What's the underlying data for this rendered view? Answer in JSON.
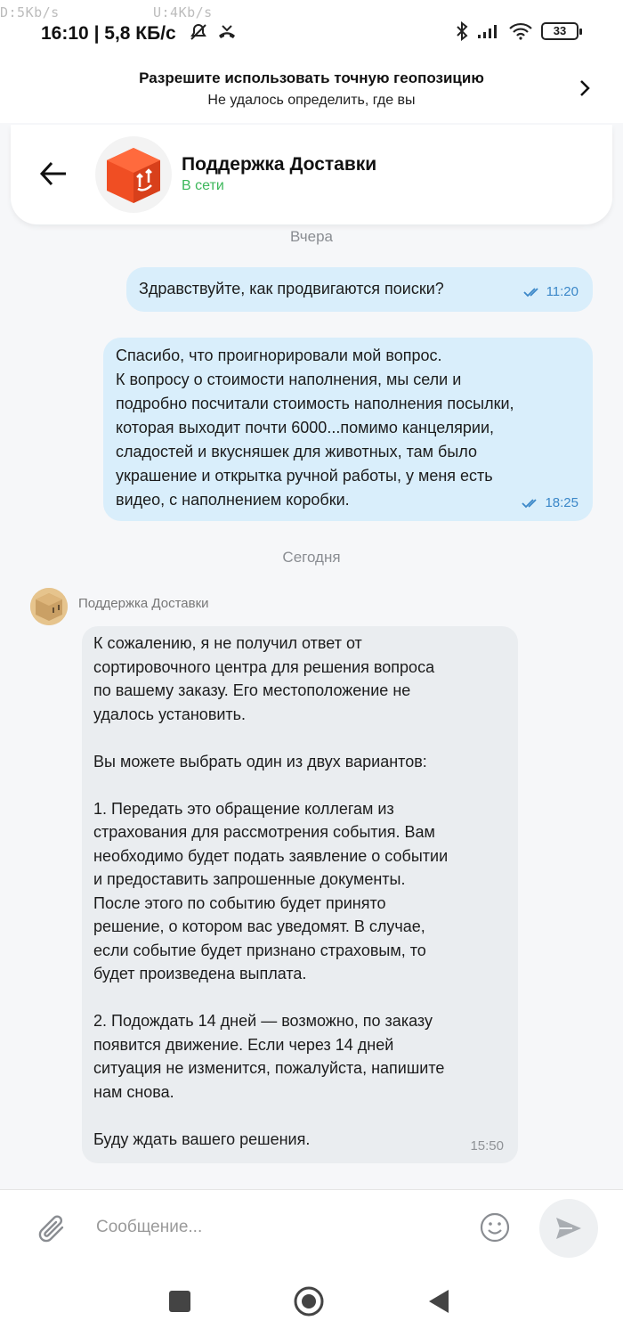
{
  "status_bar": {
    "net_down": "D:5Kb/s",
    "net_up": "U:4Kb/s",
    "time": "16:10",
    "speed": "| 5,8 КБ/с",
    "battery": "33"
  },
  "geo_banner": {
    "title": "Разрешите использовать точную геопозицию",
    "subtitle": "Не удалось определить, где вы"
  },
  "header": {
    "title": "Поддержка Доставки",
    "status": "В сети",
    "status_color": "#3cb75a",
    "brand_color": "#f04e23"
  },
  "dates": {
    "yesterday": "Вчера",
    "today": "Сегодня"
  },
  "messages": [
    {
      "direction": "outgoing",
      "text": "Здравствуйте, как продвигаются поиски?",
      "time": "11:20",
      "status_icon": "double-check-icon"
    },
    {
      "direction": "outgoing",
      "lines": [
        "Спасибо, что проигнорировали мой вопрос.",
        "К вопросу о стоимости наполнения, мы сели и",
        "подробно посчитали стоимость наполнения посылки,",
        "которая выходит почти 6000...помимо канцелярии,",
        "сладостей и вкусняшек для животных, там было",
        "украшение и открытка ручной работы, у меня есть",
        "видео, с наполнением коробки."
      ],
      "time": "18:25",
      "status_icon": "double-check-icon"
    },
    {
      "direction": "incoming",
      "sender": "Поддержка Доставки",
      "text": "К сожалению, я не получил ответ от\nсортировочного центра для решения вопроса\nпо вашему заказу. Его местоположение не\nудалось установить.\n\nВы можете выбрать один из двух вариантов:\n\n1. Передать это обращение коллегам из\nстрахования для рассмотрения события. Вам\nнеобходимо будет подать заявление о событии\nи предоставить запрошенные документы.\nПосле этого по событию будет принято\nрешение, о котором вас уведомят. В случае,\nесли событие будет признано страховым, то\nбудет произведена выплата.\n\n2. Подождать 14 дней — возможно, по заказу\nпоявится движение. Если через 14 дней\nситуация не изменится, пожалуйста, напишите\nнам снова.\n\nБуду ждать вашего решения.",
      "time": "15:50"
    }
  ],
  "input": {
    "placeholder": "Сообщение..."
  },
  "colors": {
    "outgoing_bubble": "#d9eefb",
    "incoming_bubble": "#eaedf0",
    "check_color": "#3b87c8"
  }
}
